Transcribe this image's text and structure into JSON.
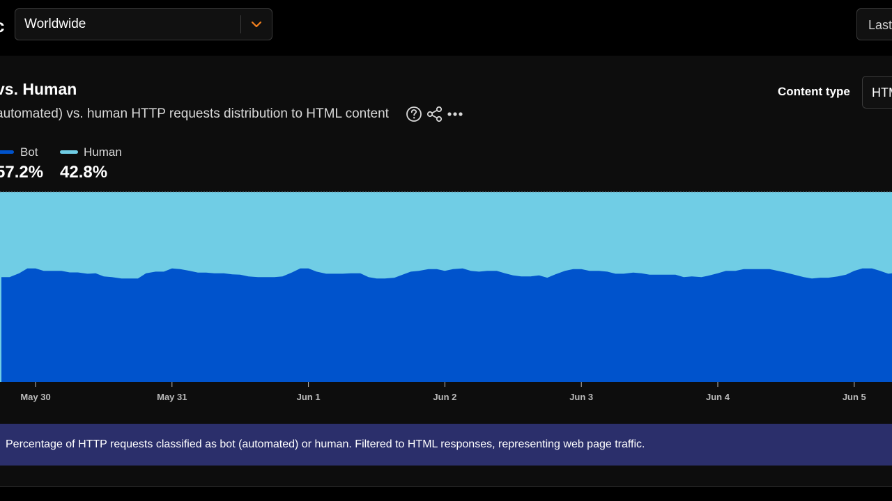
{
  "header": {
    "brand_fragment": "c",
    "location": {
      "value": "Worldwide"
    },
    "date_range": {
      "value": "Last"
    }
  },
  "panel": {
    "title": "vs. Human",
    "subtitle": "automated) vs. human HTTP requests distribution to HTML content",
    "content_type": {
      "label": "Content type",
      "value": "HTM"
    }
  },
  "legend": [
    {
      "name": "Bot",
      "value": "57.2%",
      "color": "#0053cc"
    },
    {
      "name": "Human",
      "value": "42.8%",
      "color": "#70cde5"
    }
  ],
  "caption": "Percentage of HTTP requests classified as bot (automated) or human. Filtered to HTML responses, representing web page traffic.",
  "icons": [
    "chevron-down-icon",
    "help-icon",
    "share-icon",
    "more-icon"
  ],
  "colors": {
    "accent": "#f6821f",
    "bot": "#0053cc",
    "human": "#70cde5",
    "caption_bg": "#2b2f6b"
  },
  "chart_data": {
    "type": "area",
    "stacked": true,
    "normalized_percent": true,
    "x_ticks": [
      "May 30",
      "May 31",
      "Jun 1",
      "Jun 2",
      "Jun 3",
      "Jun 4",
      "Jun 5"
    ],
    "x": [
      29.75,
      29.81,
      29.88,
      29.94,
      30.0,
      30.06,
      30.13,
      30.19,
      30.25,
      30.31,
      30.38,
      30.44,
      30.5,
      30.56,
      30.63,
      30.69,
      30.75,
      30.81,
      30.88,
      30.94,
      31.0,
      31.06,
      31.13,
      31.19,
      31.25,
      31.31,
      31.38,
      31.44,
      31.5,
      31.56,
      31.63,
      31.69,
      31.75,
      31.81,
      31.88,
      31.94,
      32.0,
      32.06,
      32.13,
      32.19,
      32.25,
      32.31,
      32.38,
      32.44,
      32.5,
      32.56,
      32.63,
      32.69,
      32.75,
      32.81,
      32.88,
      32.94,
      33.0,
      33.06,
      33.13,
      33.19,
      33.25,
      33.31,
      33.38,
      33.44,
      33.5,
      33.56,
      33.63,
      33.69,
      33.75,
      33.81,
      33.88,
      33.94,
      34.0,
      34.06,
      34.13,
      34.19,
      34.25,
      34.31,
      34.38,
      34.44,
      34.5,
      34.56,
      34.63,
      34.69,
      34.75,
      34.81,
      34.88,
      34.94,
      35.0,
      35.06,
      35.13,
      35.19,
      35.25,
      35.31,
      35.38,
      35.44,
      35.5,
      35.56,
      35.63,
      35.69,
      35.75,
      35.81,
      35.88,
      35.94,
      36.0,
      36.06,
      36.13,
      36.19,
      36.25,
      36.31,
      36.38,
      36.44,
      36.5
    ],
    "series": [
      {
        "name": "Bot",
        "values": [
          55.2,
          55.2,
          57.2,
          59.8,
          59.8,
          58.5,
          58.5,
          58.5,
          57.7,
          57.7,
          57.0,
          57.2,
          55.6,
          55.2,
          54.5,
          54.5,
          54.5,
          57.2,
          58.1,
          58.1,
          59.8,
          59.4,
          58.5,
          57.6,
          57.6,
          57.2,
          57.2,
          56.7,
          56.5,
          55.6,
          55.2,
          55.2,
          55.2,
          55.6,
          57.7,
          59.8,
          59.8,
          58.1,
          57.0,
          57.0,
          57.0,
          57.2,
          57.2,
          55.2,
          54.5,
          54.5,
          54.9,
          56.5,
          58.1,
          58.5,
          59.4,
          59.4,
          58.5,
          59.4,
          59.8,
          58.5,
          58.1,
          58.5,
          58.5,
          57.2,
          56.1,
          55.6,
          55.6,
          56.1,
          54.9,
          56.7,
          58.5,
          59.4,
          59.4,
          58.5,
          58.5,
          58.1,
          57.0,
          57.0,
          57.6,
          57.2,
          56.5,
          56.5,
          56.5,
          56.5,
          55.2,
          55.6,
          55.2,
          56.1,
          57.2,
          58.5,
          58.5,
          59.4,
          59.4,
          59.4,
          59.4,
          58.5,
          57.6,
          56.5,
          55.2,
          54.5,
          54.9,
          54.9,
          55.6,
          56.5,
          58.5,
          59.8,
          59.8,
          58.5,
          57.0,
          57.6,
          57.6,
          57.2,
          57.2
        ]
      },
      {
        "name": "Human",
        "values": [
          44.8,
          44.8,
          42.8,
          40.2,
          40.2,
          41.5,
          41.5,
          41.5,
          42.3,
          42.3,
          43.0,
          42.8,
          44.4,
          44.8,
          45.5,
          45.5,
          45.5,
          42.8,
          41.9,
          41.9,
          40.2,
          40.6,
          41.5,
          42.4,
          42.4,
          42.8,
          42.8,
          43.3,
          43.5,
          44.4,
          44.8,
          44.8,
          44.8,
          44.4,
          42.3,
          40.2,
          40.2,
          41.9,
          43.0,
          43.0,
          43.0,
          42.8,
          42.8,
          44.8,
          45.5,
          45.5,
          45.1,
          43.5,
          41.9,
          41.5,
          40.6,
          40.6,
          41.5,
          40.6,
          40.2,
          41.5,
          41.9,
          41.5,
          41.5,
          42.8,
          43.9,
          44.4,
          44.4,
          43.9,
          45.1,
          43.3,
          41.5,
          40.6,
          40.6,
          41.5,
          41.5,
          41.9,
          43.0,
          43.0,
          42.4,
          42.8,
          43.5,
          43.5,
          43.5,
          43.5,
          44.8,
          44.4,
          44.8,
          43.9,
          42.8,
          41.5,
          41.5,
          40.6,
          40.6,
          40.6,
          40.6,
          41.5,
          42.4,
          43.5,
          44.8,
          45.5,
          45.1,
          45.1,
          44.4,
          43.5,
          41.5,
          40.2,
          40.2,
          41.5,
          43.0,
          42.4,
          42.4,
          42.8,
          42.8
        ]
      }
    ],
    "ylim": [
      0,
      100
    ],
    "grid": false
  }
}
